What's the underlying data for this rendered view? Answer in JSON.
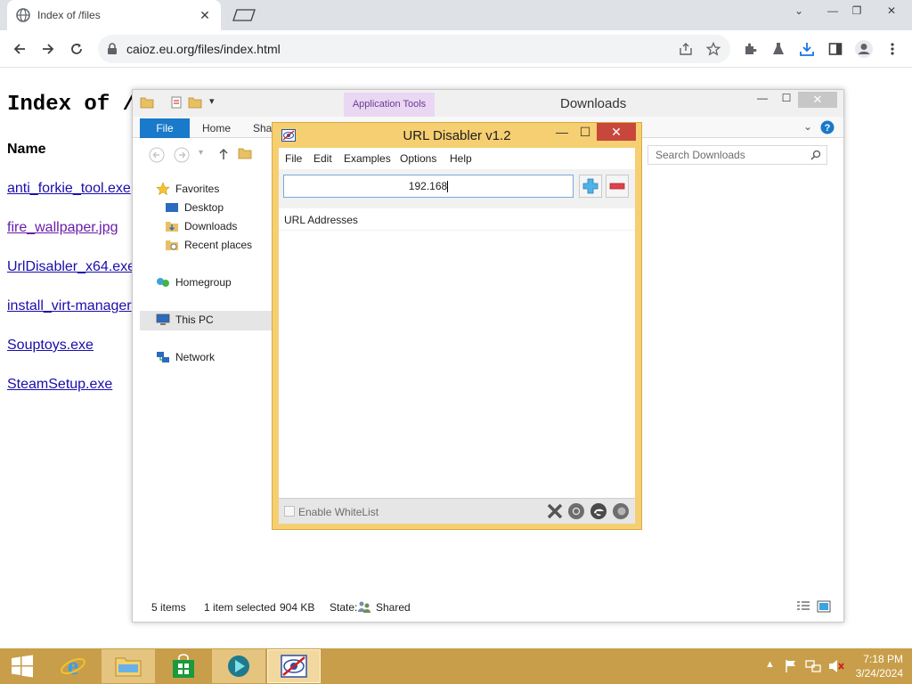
{
  "browser": {
    "tab_title": "Index of /files",
    "url": "caioz.eu.org/files/index.html"
  },
  "page": {
    "heading": "Index of /files",
    "name_header": "Name",
    "files": [
      {
        "name": "anti_forkie_tool.exe",
        "visited": false
      },
      {
        "name": "fire_wallpaper.jpg",
        "visited": true
      },
      {
        "name": "UrlDisabler_x64.exe",
        "visited": false
      },
      {
        "name": "install_virt-manager",
        "visited": false
      },
      {
        "name": "Souptoys.exe",
        "visited": false
      },
      {
        "name": "SteamSetup.exe",
        "visited": false
      }
    ]
  },
  "explorer": {
    "title": "Downloads",
    "app_tools": "Application Tools",
    "ribbon_tabs": [
      "File",
      "Home",
      "Share"
    ],
    "search_placeholder": "Search Downloads",
    "nav": {
      "favorites": "Favorites",
      "desktop": "Desktop",
      "downloads": "Downloads",
      "recent": "Recent places",
      "homegroup": "Homegroup",
      "this_pc": "This PC",
      "network": "Network"
    },
    "status": {
      "items": "5 items",
      "selected": "1 item selected",
      "size": "904 KB",
      "state_label": "State:",
      "state_value": "Shared"
    }
  },
  "url_disabler": {
    "title": "URL Disabler v1.2",
    "menu": [
      "File",
      "Edit",
      "Examples",
      "Options",
      "Help"
    ],
    "input_value": "192.168",
    "list_header": "URL Addresses",
    "whitelist_label": "Enable WhiteList",
    "whitelist_checked": false
  },
  "taskbar": {
    "time": "7:18 PM",
    "date": "3/24/2024"
  },
  "colors": {
    "taskbar": "#c89e4a",
    "url_disabler_frame": "#f5cf72",
    "close_red": "#c7473c",
    "link": "#1a0dab",
    "visited_link": "#681da8",
    "ribbon_file": "#1979ca"
  }
}
